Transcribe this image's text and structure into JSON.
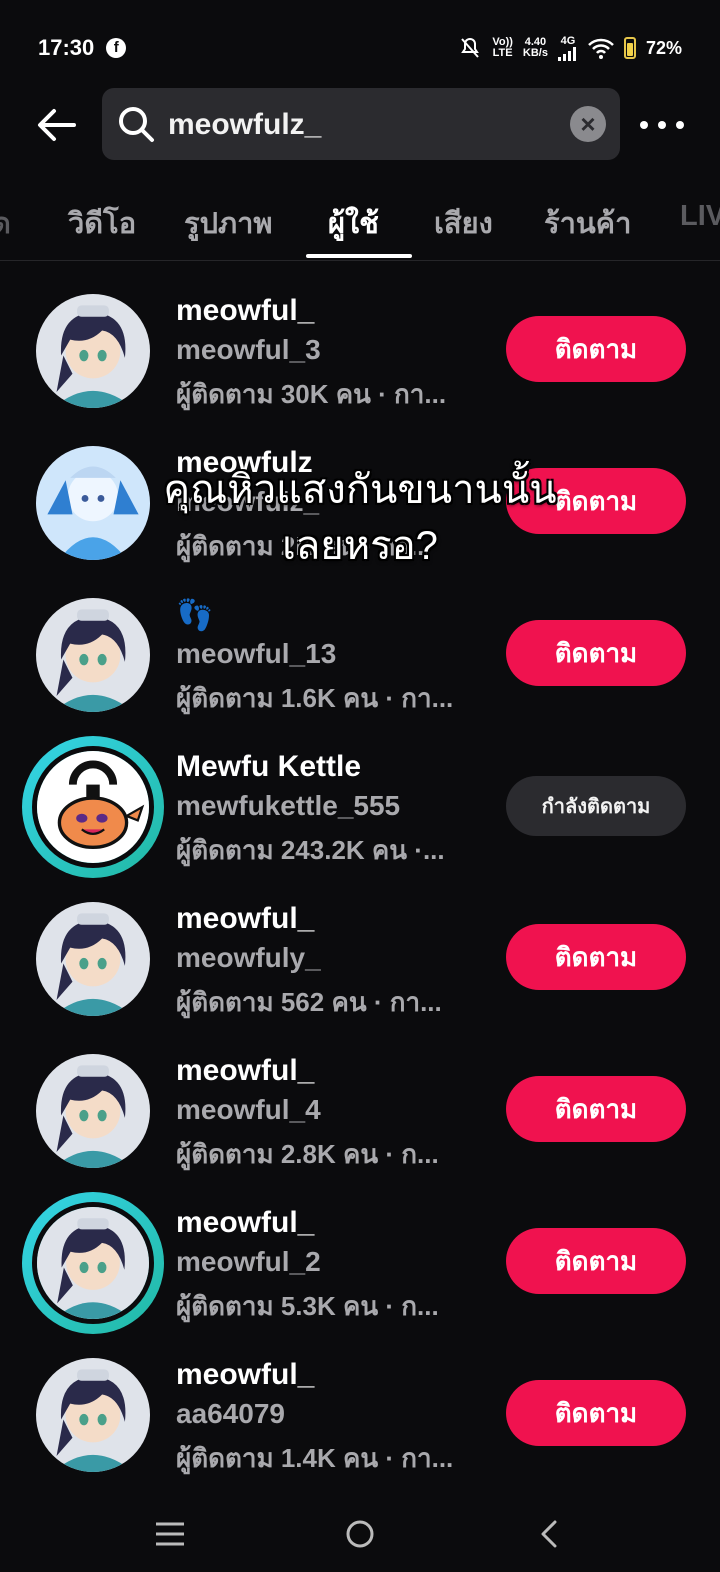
{
  "status_bar": {
    "time": "17:30",
    "network_speed_top": "4.40",
    "network_speed_bottom": "KB/s",
    "volte_top": "Vo))",
    "volte_bottom": "LTE",
    "net_type": "4G",
    "battery": "72%"
  },
  "search": {
    "query": "meowfulz_"
  },
  "tabs": [
    "ด",
    "วิดีโอ",
    "รูปภาพ",
    "ผู้ใช้",
    "เสียง",
    "ร้านค้า",
    "LIV"
  ],
  "active_tab_index": 3,
  "follow_label": "ติดตาม",
  "following_label": "กำลังติดตาม",
  "users": [
    {
      "name": "meowful_",
      "handle": "meowful_3",
      "stats": "ผู้ติดตาม 30K คน · กา...",
      "state": "follow",
      "ring": false,
      "avatar": "anime-girl"
    },
    {
      "name": "meowfulz",
      "handle": "meowfulz_",
      "stats": "ผู้ติดตาม 2K คน · กา...",
      "state": "follow",
      "ring": false,
      "avatar": "blue-character"
    },
    {
      "name": "👣",
      "handle": "meowful_13",
      "stats": "ผู้ติดตาม 1.6K คน · กา...",
      "state": "follow",
      "ring": false,
      "avatar": "anime-girl"
    },
    {
      "name": "Mewfu Kettle",
      "handle": "mewfukettle_555",
      "stats": "ผู้ติดตาม 243.2K คน ·...",
      "state": "following",
      "ring": true,
      "avatar": "kettle"
    },
    {
      "name": "meowful_",
      "handle": "meowfuly_",
      "stats": "ผู้ติดตาม 562 คน · กา...",
      "state": "follow",
      "ring": false,
      "avatar": "anime-girl"
    },
    {
      "name": "meowful_",
      "handle": "meowful_4",
      "stats": "ผู้ติดตาม 2.8K คน · ก...",
      "state": "follow",
      "ring": false,
      "avatar": "anime-girl"
    },
    {
      "name": "meowful_",
      "handle": "meowful_2",
      "stats": "ผู้ติดตาม 5.3K คน · ก...",
      "state": "follow",
      "ring": true,
      "avatar": "anime-girl"
    },
    {
      "name": "meowful_",
      "handle": "aa64079",
      "stats": "ผู้ติดตาม 1.4K คน · กา...",
      "state": "follow",
      "ring": false,
      "avatar": "anime-girl"
    }
  ],
  "caption": {
    "line1": "คุณหิวแสงกันขนานนั้น",
    "line2": "เลยหรอ?"
  },
  "colors": {
    "background": "#0b0b0d",
    "accent": "#f0124f",
    "ring": "#35d5e8"
  }
}
